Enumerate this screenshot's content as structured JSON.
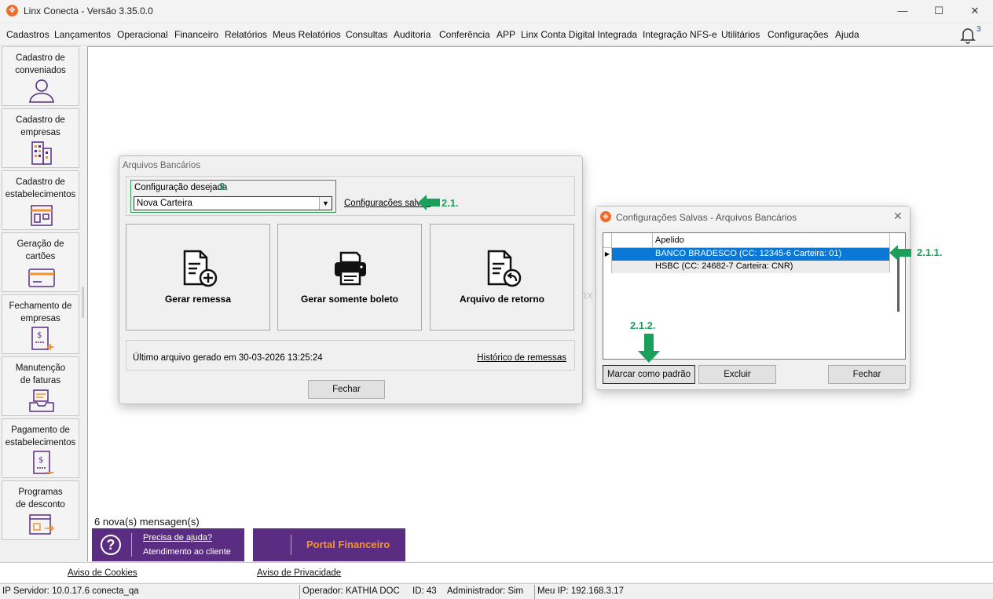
{
  "window": {
    "title": "Linx Conecta - Versão 3.35.0.0",
    "minimize": "—",
    "maximize": "☐",
    "close": "✕",
    "logo_glyph": "✥"
  },
  "menu": {
    "items": [
      "Cadastros",
      "Lançamentos",
      "Operacional",
      "Financeiro",
      "Relatórios",
      "Meus Relatórios",
      "Consultas",
      "Auditoria",
      "Conferência",
      "APP",
      "Linx Conta Digital Integrada",
      "Integração NFS-e",
      "Utilitários",
      "Configurações",
      "Ajuda"
    ],
    "notification_count": "3"
  },
  "sidebar": {
    "items": [
      {
        "label1": "Cadastro de",
        "label2": "conveniados",
        "icon": "user-icon"
      },
      {
        "label1": "Cadastro de",
        "label2": "empresas",
        "icon": "building-icon"
      },
      {
        "label1": "Cadastro de",
        "label2": "estabelecimentos",
        "icon": "store-icon"
      },
      {
        "label1": "Geração de",
        "label2": "cartões",
        "icon": "card-icon"
      },
      {
        "label1": "Fechamento de",
        "label2": "empresas",
        "icon": "invoice-icon"
      },
      {
        "label1": "Manutenção",
        "label2": "de faturas",
        "icon": "tray-icon"
      },
      {
        "label1": "Pagamento de",
        "label2": "estabelecimentos",
        "icon": "payment-icon"
      },
      {
        "label1": "Programas",
        "label2": "de desconto",
        "icon": "discount-icon"
      }
    ]
  },
  "workspace": {
    "watermark": "nx",
    "messages": "6 nova(s) mensagen(s)",
    "help": {
      "link": "Precisa de ajuda?",
      "subtitle": "Atendimento ao cliente"
    },
    "portal": "Portal Financeiro"
  },
  "dialog_arquivos": {
    "title": "Arquivos Bancários",
    "config_label": "Configuração desejada",
    "step_2": "2.",
    "config_value": "Nova Carteira",
    "saved_link": "Configurações salvas",
    "step_2_1": "2.1.",
    "buttons": [
      {
        "label": "Gerar remessa",
        "icon": "document-add-icon"
      },
      {
        "label": "Gerar somente boleto",
        "icon": "printer-icon"
      },
      {
        "label": "Arquivo de retorno",
        "icon": "document-return-icon"
      }
    ],
    "last_file": "Último arquivo gerado em 30-03-2026 13:25:24",
    "history_link": "Histórico de remessas",
    "close_button": "Fechar"
  },
  "dialog_salvas": {
    "title": "Configurações Salvas - Arquivos Bancários",
    "close_glyph": "✕",
    "column_header": "Apelido",
    "rows": [
      {
        "value": "BANCO BRADESCO (CC: 12345-6 Carteira: 01)",
        "selected": true
      },
      {
        "value": "HSBC (CC: 24682-7 Carteira: CNR)",
        "selected": false
      }
    ],
    "step_2_1_1": "2.1.1.",
    "step_2_1_2": "2.1.2.",
    "buttons": {
      "default": "Marcar como padrão",
      "delete": "Excluir",
      "close": "Fechar"
    }
  },
  "footer": {
    "cookies": "Aviso de Cookies",
    "privacy": "Aviso de Privacidade"
  },
  "status": {
    "server": "IP Servidor: 10.0.17.6 conecta_qa",
    "operator": "Operador: KATHIA DOC",
    "id": "ID: 43",
    "admin": "Administrador: Sim",
    "my_ip": "Meu IP: 192.168.3.17"
  },
  "colors": {
    "accent_purple": "#5a2d82",
    "portal_orange": "#f39330",
    "annotation_green": "#1aa05a",
    "selection_blue": "#0a78d7",
    "logo_orange": "#ef6c2d"
  }
}
